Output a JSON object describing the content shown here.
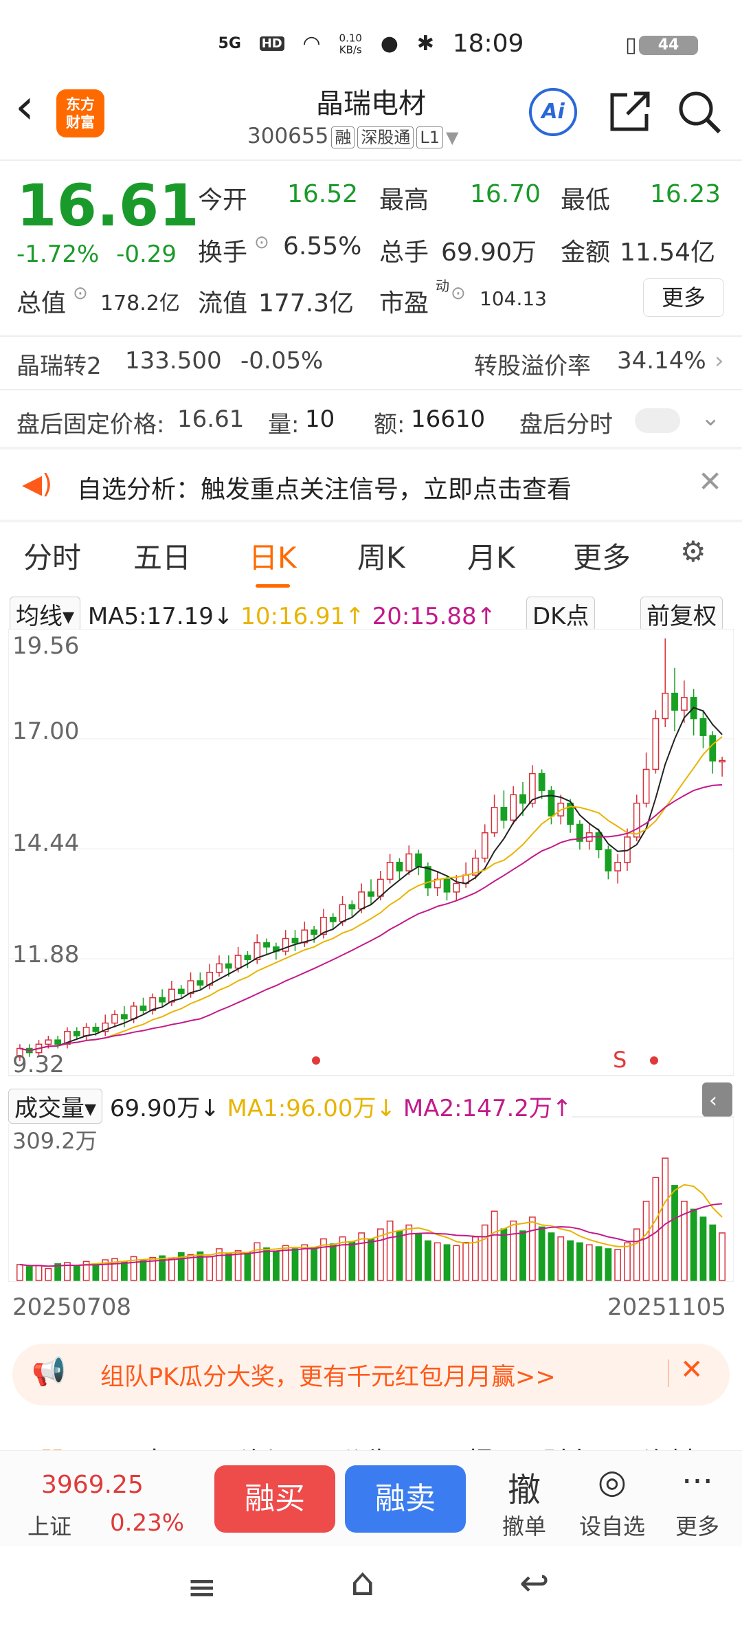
{
  "status_bar": {
    "network": "5G",
    "hd": "HD",
    "speed_value": "0.10",
    "speed_unit": "KB/s",
    "time": "18:09",
    "battery": "44"
  },
  "header": {
    "back_label": "‹",
    "logo_line1": "东方",
    "logo_line2": "财富",
    "title": "晶瑞电材",
    "code": "300655",
    "tags": [
      "融",
      "深股通",
      "L1"
    ],
    "ai_label": "Ai"
  },
  "quote": {
    "price": "16.61",
    "change_pct": "-1.72%",
    "change_abs": "-0.29",
    "open_label": "今开",
    "open": "16.52",
    "high_label": "最高",
    "high": "16.70",
    "low_label": "最低",
    "low": "16.23",
    "turnover_label": "换手",
    "turnover": "6.55%",
    "volume_label": "总手",
    "volume": "69.90万",
    "amount_label": "金额",
    "amount": "11.54亿",
    "mktcap_label": "总值",
    "mktcap": "178.2亿",
    "float_label": "流值",
    "float": "177.3亿",
    "pe_label": "市盈",
    "pe_sup": "动",
    "pe": "104.13",
    "more_label": "更多"
  },
  "bond": {
    "name": "晶瑞转2",
    "price": "133.500",
    "change": "-0.05%",
    "premium_label": "转股溢价率",
    "premium": "34.14%"
  },
  "after_hours": {
    "price_label": "盘后固定价格:",
    "price": "16.61",
    "qty_label": "量:",
    "qty": "10",
    "amt_label": "额:",
    "amt": "16610",
    "time_label": "盘后分时"
  },
  "notice": {
    "text": "自选分析：触发重点关注信号，立即点击查看"
  },
  "tabs": [
    "分时",
    "五日",
    "日K",
    "周K",
    "月K",
    "更多"
  ],
  "ma": {
    "selector": "均线",
    "ma5": "MA5:17.19",
    "ma10": "10:16.91",
    "ma20": "20:15.88",
    "dk": "DK点",
    "adjust": "前复权"
  },
  "price_axis": [
    "19.56",
    "17.00",
    "14.44",
    "11.88",
    "9.32"
  ],
  "volume_panel": {
    "selector": "成交量",
    "vol": "69.90万",
    "ma1": "MA1:96.00万",
    "ma2": "MA2:147.2万",
    "max": "309.2万"
  },
  "dates": {
    "start": "20250708",
    "end": "20251105"
  },
  "promo": {
    "text": "组队PK瓜分大奖，更有千元红包月月赢>>"
  },
  "bottom_tabs": [
    "股吧",
    "盘口",
    "资讯",
    "公告",
    "研报",
    "财务",
    "资料"
  ],
  "bottom": {
    "index_value": "3969.25",
    "index_name": "上证",
    "index_change": "0.23%",
    "buy": "融买",
    "sell": "融卖",
    "cancel_icon": "撤",
    "cancel": "撤单",
    "watch": "设自选",
    "more": "更多"
  },
  "chart_data": {
    "type": "candlestick",
    "ylim": [
      9.32,
      19.56
    ],
    "x_start": "20250708",
    "x_end": "20251105",
    "candles": [
      [
        9.6,
        9.8,
        9.5,
        9.9
      ],
      [
        9.8,
        9.7,
        9.6,
        9.9
      ],
      [
        9.7,
        9.9,
        9.6,
        10.0
      ],
      [
        9.9,
        10.0,
        9.8,
        10.1
      ],
      [
        10.0,
        9.9,
        9.8,
        10.1
      ],
      [
        9.9,
        10.2,
        9.8,
        10.3
      ],
      [
        10.2,
        10.1,
        10.0,
        10.3
      ],
      [
        10.1,
        10.3,
        10.0,
        10.4
      ],
      [
        10.3,
        10.2,
        10.1,
        10.4
      ],
      [
        10.2,
        10.4,
        10.1,
        10.6
      ],
      [
        10.4,
        10.6,
        10.3,
        10.7
      ],
      [
        10.6,
        10.5,
        10.3,
        10.8
      ],
      [
        10.5,
        10.8,
        10.4,
        10.9
      ],
      [
        10.8,
        10.7,
        10.6,
        11.0
      ],
      [
        10.7,
        11.0,
        10.6,
        11.1
      ],
      [
        11.0,
        10.9,
        10.8,
        11.2
      ],
      [
        10.9,
        11.2,
        10.8,
        11.4
      ],
      [
        11.2,
        11.1,
        11.0,
        11.3
      ],
      [
        11.1,
        11.4,
        11.0,
        11.6
      ],
      [
        11.4,
        11.3,
        11.2,
        11.6
      ],
      [
        11.3,
        11.6,
        11.2,
        11.8
      ],
      [
        11.6,
        11.8,
        11.5,
        12.0
      ],
      [
        11.8,
        11.7,
        11.5,
        12.0
      ],
      [
        11.7,
        12.0,
        11.6,
        12.2
      ],
      [
        12.0,
        11.9,
        11.7,
        12.1
      ],
      [
        11.9,
        12.3,
        11.8,
        12.5
      ],
      [
        12.3,
        12.2,
        12.0,
        12.4
      ],
      [
        12.2,
        12.1,
        11.9,
        12.3
      ],
      [
        12.1,
        12.4,
        12.0,
        12.6
      ],
      [
        12.4,
        12.3,
        12.1,
        12.6
      ],
      [
        12.3,
        12.6,
        12.2,
        12.8
      ],
      [
        12.6,
        12.5,
        12.3,
        12.7
      ],
      [
        12.5,
        12.9,
        12.4,
        13.1
      ],
      [
        12.9,
        12.8,
        12.6,
        13.0
      ],
      [
        12.8,
        13.2,
        12.7,
        13.4
      ],
      [
        13.2,
        13.1,
        12.9,
        13.3
      ],
      [
        13.1,
        13.5,
        13.0,
        13.7
      ],
      [
        13.5,
        13.4,
        13.2,
        13.8
      ],
      [
        13.4,
        13.8,
        13.3,
        14.0
      ],
      [
        13.8,
        14.2,
        13.7,
        14.4
      ],
      [
        14.2,
        14.0,
        13.8,
        14.3
      ],
      [
        14.0,
        14.4,
        13.9,
        14.6
      ],
      [
        14.4,
        14.1,
        13.9,
        14.5
      ],
      [
        14.1,
        13.6,
        13.4,
        14.2
      ],
      [
        13.6,
        13.8,
        13.4,
        14.0
      ],
      [
        13.8,
        13.5,
        13.3,
        13.9
      ],
      [
        13.5,
        13.7,
        13.3,
        13.9
      ],
      [
        13.7,
        13.9,
        13.6,
        14.2
      ],
      [
        13.9,
        14.3,
        13.8,
        14.5
      ],
      [
        14.3,
        14.9,
        14.2,
        15.1
      ],
      [
        14.9,
        15.5,
        14.8,
        15.8
      ],
      [
        15.5,
        15.2,
        15.0,
        15.9
      ],
      [
        15.2,
        15.8,
        15.1,
        16.0
      ],
      [
        15.8,
        15.6,
        15.3,
        16.1
      ],
      [
        15.6,
        16.3,
        15.5,
        16.5
      ],
      [
        16.3,
        15.9,
        15.7,
        16.4
      ],
      [
        15.9,
        15.3,
        15.1,
        16.0
      ],
      [
        15.3,
        15.6,
        15.1,
        15.8
      ],
      [
        15.6,
        15.1,
        14.9,
        15.7
      ],
      [
        15.1,
        14.7,
        14.5,
        15.2
      ],
      [
        14.7,
        14.9,
        14.5,
        15.1
      ],
      [
        14.9,
        14.5,
        14.3,
        15.0
      ],
      [
        14.5,
        14.0,
        13.8,
        14.6
      ],
      [
        14.0,
        14.2,
        13.7,
        14.4
      ],
      [
        14.2,
        14.8,
        14.0,
        15.0
      ],
      [
        14.8,
        15.6,
        14.7,
        15.8
      ],
      [
        15.6,
        16.4,
        15.5,
        16.8
      ],
      [
        16.4,
        17.6,
        16.3,
        17.8
      ],
      [
        17.6,
        18.2,
        17.4,
        19.5
      ],
      [
        18.2,
        17.8,
        17.3,
        18.8
      ],
      [
        17.8,
        18.1,
        17.5,
        18.5
      ],
      [
        18.1,
        17.6,
        17.2,
        18.3
      ],
      [
        17.6,
        17.2,
        16.9,
        17.8
      ],
      [
        17.2,
        16.6,
        16.3,
        17.3
      ],
      [
        16.6,
        16.61,
        16.23,
        16.7
      ]
    ],
    "volumes": [
      40,
      35,
      38,
      30,
      42,
      45,
      36,
      48,
      40,
      52,
      55,
      47,
      60,
      50,
      58,
      62,
      54,
      70,
      65,
      72,
      60,
      80,
      68,
      75,
      70,
      95,
      82,
      74,
      88,
      80,
      90,
      84,
      105,
      92,
      110,
      98,
      120,
      105,
      130,
      150,
      125,
      140,
      118,
      100,
      95,
      90,
      88,
      96,
      110,
      140,
      175,
      130,
      150,
      125,
      160,
      135,
      120,
      110,
      100,
      95,
      90,
      85,
      80,
      78,
      95,
      130,
      200,
      260,
      309,
      240,
      200,
      180,
      160,
      140,
      120
    ],
    "legend": {
      "ma5": "MA5",
      "ma10": "MA10",
      "ma20": "MA20"
    }
  }
}
